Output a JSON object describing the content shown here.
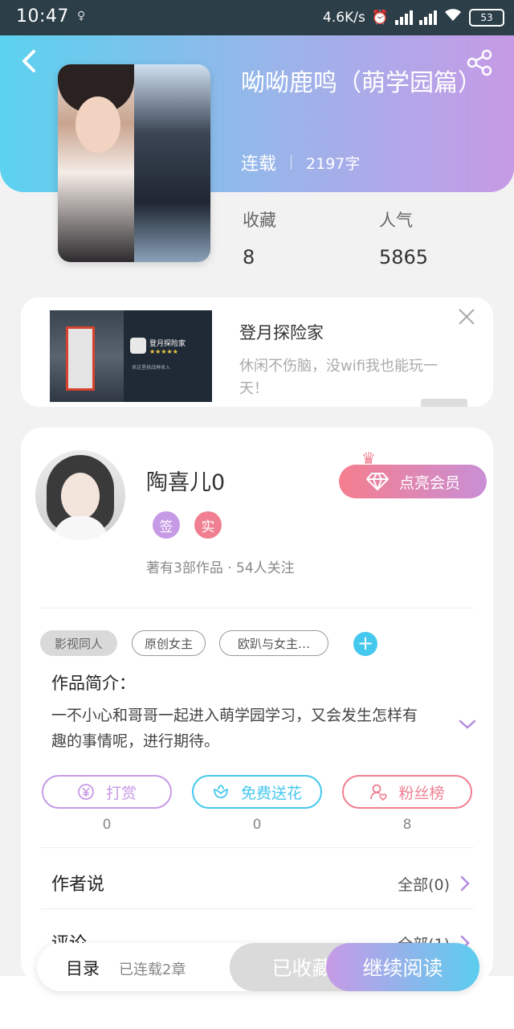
{
  "status_bar": {
    "time": "10:47",
    "net_speed": "4.6K/s",
    "battery": "53"
  },
  "book": {
    "title": "呦呦鹿鸣（萌学园篇）",
    "status": "连载",
    "word_count": "2197字",
    "stats": [
      {
        "label": "收藏",
        "value": "8"
      },
      {
        "label": "人气",
        "value": "5865"
      }
    ]
  },
  "ad": {
    "title": "登月探险家",
    "description": "休闲不伤脑，没wifi我也能玩一天！",
    "image_app_name": "登月探险家",
    "image_stars": "★★★★★",
    "image_subtitle": "来这里挑战再收入"
  },
  "author": {
    "name": "陶喜儿0",
    "badges": [
      "签",
      "实"
    ],
    "meta": "著有3部作品 · 54人关注",
    "vip_button": "点亮会员"
  },
  "tags": [
    "影视同人",
    "原创女主",
    "欧趴与女主…"
  ],
  "intro": {
    "title": "作品简介：",
    "text": "一不小心和哥哥一起进入萌学园学习，又会发生怎样有趣的事情呢，进行期待。"
  },
  "actions": [
    {
      "label": "打赏",
      "count": "0",
      "color": "#c79ae6"
    },
    {
      "label": "免费送花",
      "count": "0",
      "color": "#45c8ee"
    },
    {
      "label": "粉丝榜",
      "count": "8",
      "color": "#f07f91"
    }
  ],
  "sections": [
    {
      "title": "作者说",
      "right": "全部(0)"
    },
    {
      "title": "评论",
      "right": "全部(1)"
    }
  ],
  "bottom_bar": {
    "catalog": "目录",
    "chapters": "已连载2章",
    "collected": "已收藏",
    "continue": "继续阅读"
  }
}
